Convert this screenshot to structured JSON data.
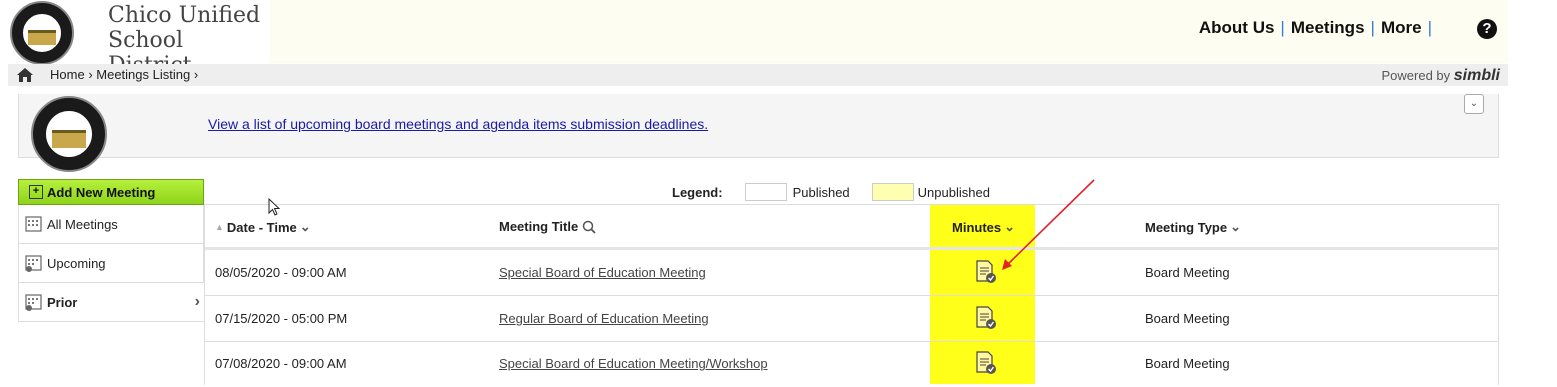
{
  "header": {
    "logo_text": "CHICO UNIFIED SCHOOL DISTRICT",
    "district_line1": "Chico Unified",
    "district_line2": "School District",
    "nav": [
      "About Us",
      "Meetings",
      "More"
    ],
    "help_icon": "question-circle-icon"
  },
  "breadcrumb": {
    "home_icon": "home-icon",
    "items": [
      "Home",
      "Meetings Listing"
    ],
    "powered_by": "Powered by",
    "brand": "simbli"
  },
  "banner": {
    "link_text": "View a list of upcoming board meetings and agenda items submission deadlines."
  },
  "sidebar": {
    "add_label": "Add New Meeting",
    "items": [
      {
        "label": "All Meetings",
        "active": false
      },
      {
        "label": "Upcoming",
        "active": false
      },
      {
        "label": "Prior",
        "active": true
      }
    ]
  },
  "legend": {
    "label": "Legend:",
    "published": "Published",
    "unpublished": "Unpublished",
    "published_color": "#ffffff",
    "unpublished_color": "#ffffb0"
  },
  "table": {
    "headers": {
      "date_time": "Date - Time",
      "title": "Meeting Title",
      "minutes": "Minutes",
      "type": "Meeting Type"
    },
    "rows": [
      {
        "date": "08/05/2020 - 09:00 AM",
        "title": "Special Board of Education Meeting",
        "type": "Board Meeting"
      },
      {
        "date": "07/15/2020 - 05:00 PM",
        "title": "Regular Board of Education Meeting",
        "type": "Board Meeting"
      },
      {
        "date": "07/08/2020 - 09:00 AM",
        "title": "Special Board of Education Meeting/Workshop",
        "type": "Board Meeting"
      }
    ]
  },
  "colors": {
    "highlight": "#ffff1a",
    "annotation_arrow": "#e0242a",
    "add_button": "#9adf2a"
  }
}
